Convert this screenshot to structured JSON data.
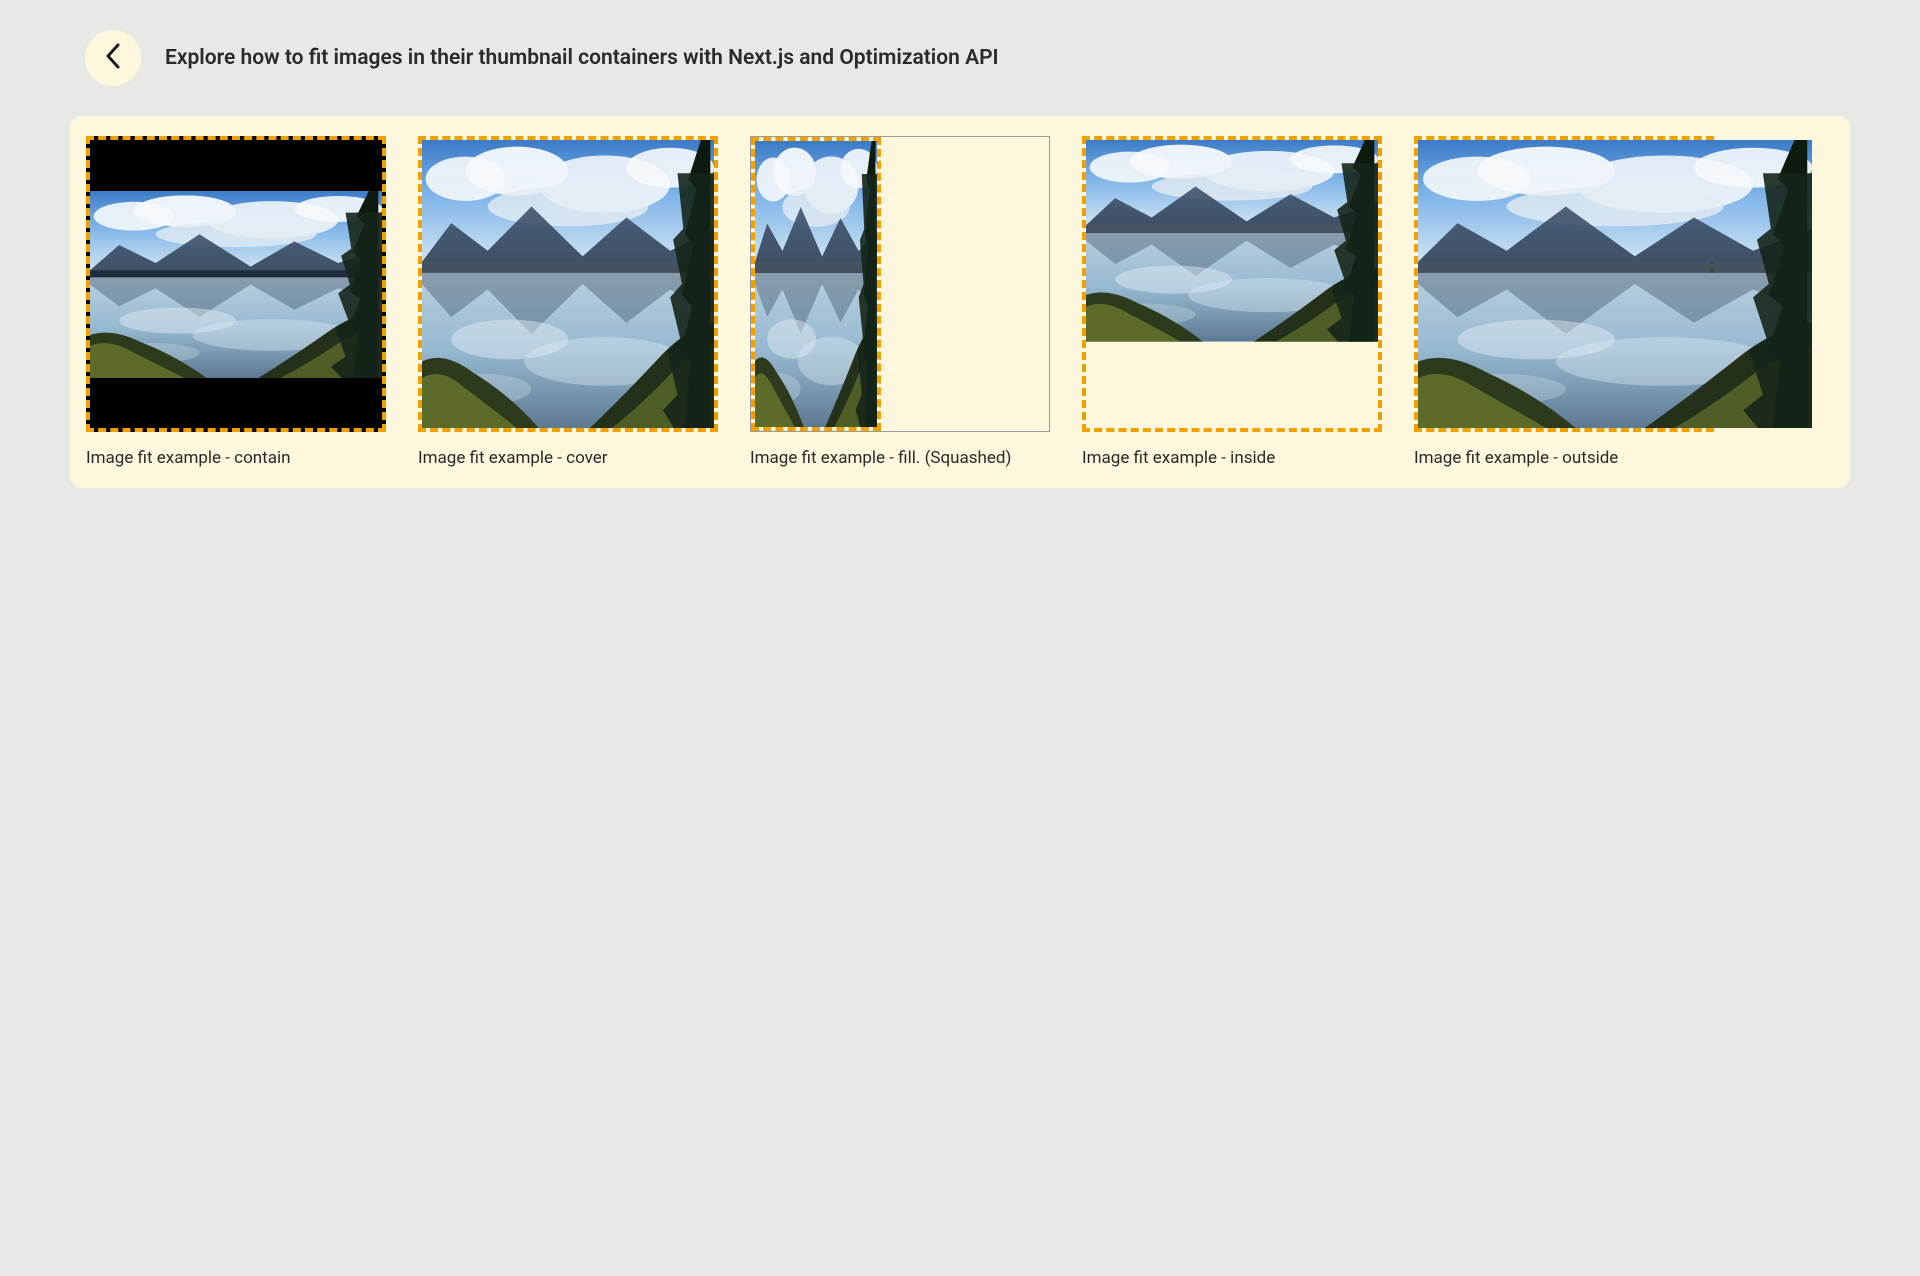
{
  "header": {
    "title": "Explore how to fit images in their thumbnail containers with Next.js and Optimization API"
  },
  "items": [
    {
      "caption": "Image fit example - contain",
      "mode": "contain"
    },
    {
      "caption": "Image fit example - cover",
      "mode": "cover"
    },
    {
      "caption": "Image fit example - fill. (Squashed)",
      "mode": "fill"
    },
    {
      "caption": "Image fit example - inside",
      "mode": "inside"
    },
    {
      "caption": "Image fit example - outside",
      "mode": "outside"
    }
  ]
}
